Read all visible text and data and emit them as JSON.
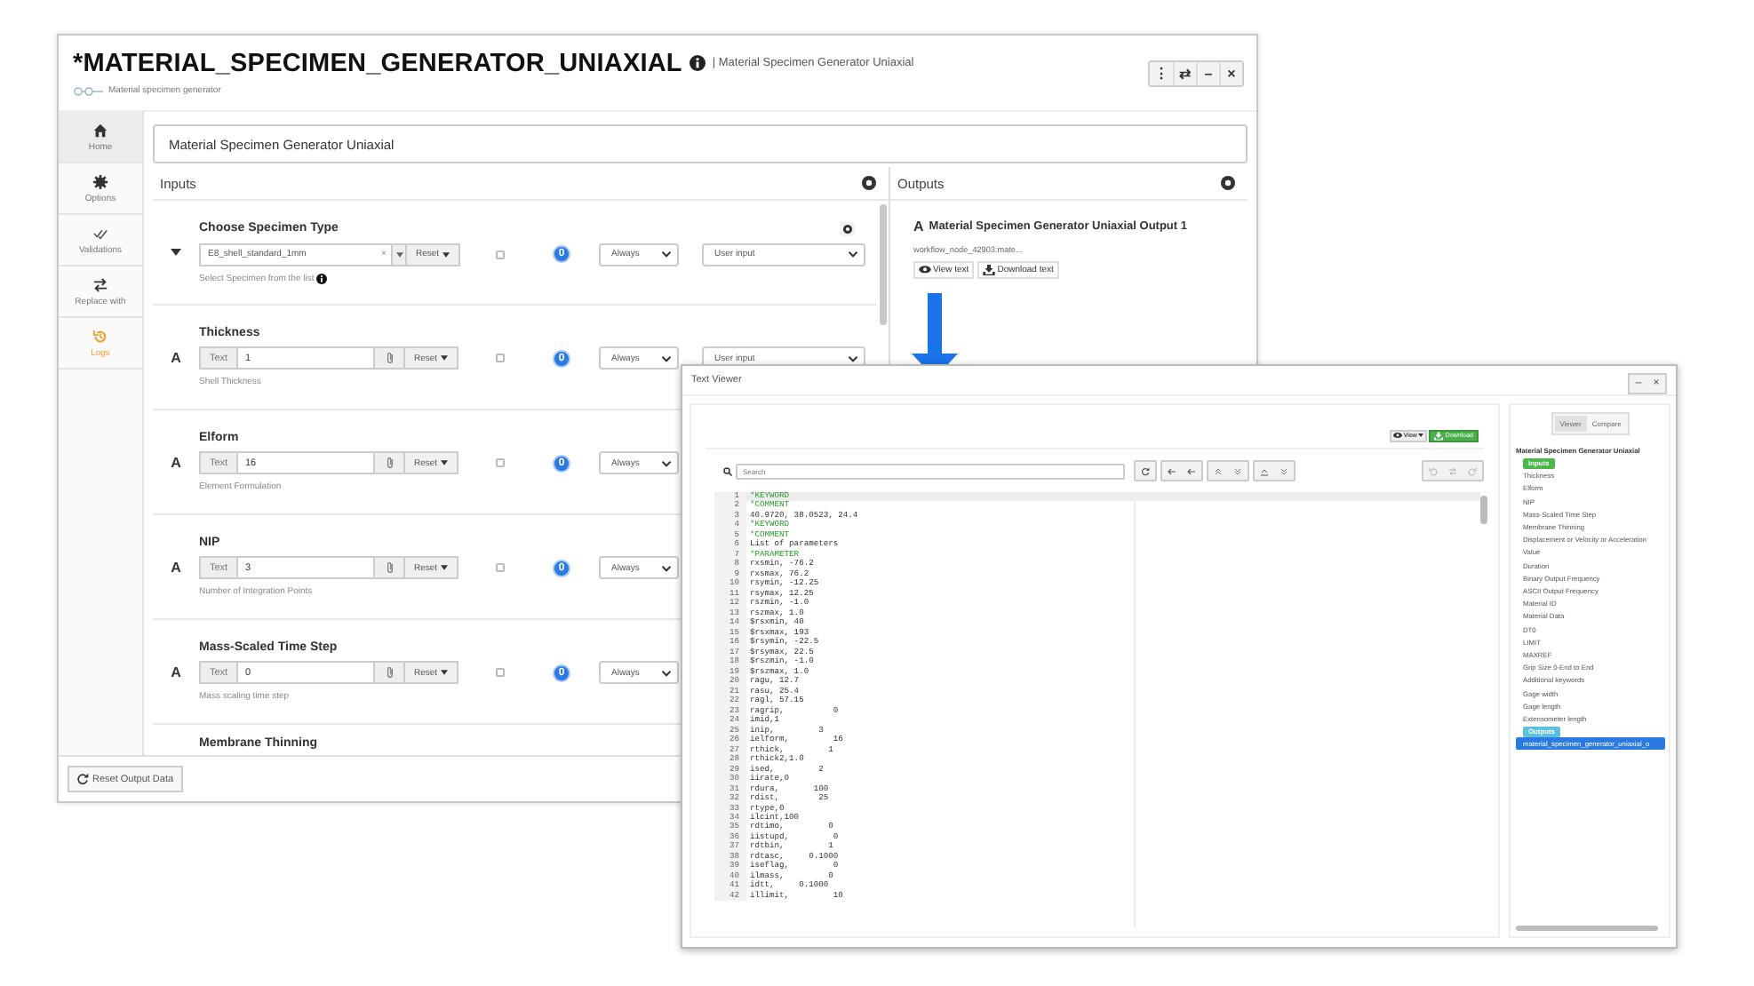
{
  "window": {
    "title": "*MATERIAL_SPECIMEN_GENERATOR_UNIAXIAL",
    "subtitle": "| Material Specimen Generator Uniaxial",
    "description": "Material specimen generator",
    "controls": [
      "⋮",
      "⇄",
      "–",
      "×"
    ]
  },
  "sidebar": {
    "items": [
      {
        "label": "Home",
        "selected": true,
        "highlighted": false
      },
      {
        "label": "Options",
        "selected": false,
        "highlighted": false
      },
      {
        "label": "Validations",
        "selected": false,
        "highlighted": false
      },
      {
        "label": "Replace with",
        "selected": false,
        "highlighted": false
      },
      {
        "label": "Logs",
        "selected": false,
        "highlighted": true
      }
    ]
  },
  "name_field": {
    "value": "Material Specimen Generator Uniaxial"
  },
  "inputs": {
    "title": "Inputs",
    "rows": [
      {
        "kind": "select",
        "label": "Choose Specimen Type",
        "value": "E8_shell_standard_1mm",
        "clear": "×",
        "reset": "Reset",
        "hint": "Select Specimen from the list",
        "checked": false,
        "count": "0",
        "frequency": "Always",
        "source": "User input"
      },
      {
        "kind": "text",
        "type_label": "A",
        "label": "Thickness",
        "prefix": "Text",
        "value": "1",
        "reset": "Reset",
        "hint": "Shell Thickness",
        "checked": false,
        "count": "0",
        "frequency": "Always",
        "source": "User input"
      },
      {
        "kind": "text",
        "type_label": "A",
        "label": "Elform",
        "prefix": "Text",
        "value": "16",
        "reset": "Reset",
        "hint": "Element Formulation",
        "checked": false,
        "count": "0",
        "frequency": "Always"
      },
      {
        "kind": "text",
        "type_label": "A",
        "label": "NIP",
        "prefix": "Text",
        "value": "3",
        "reset": "Reset",
        "hint": "Number of Integration Points",
        "checked": false,
        "count": "0",
        "frequency": "Always"
      },
      {
        "kind": "text",
        "type_label": "A",
        "label": "Mass-Scaled Time Step",
        "prefix": "Text",
        "value": "0",
        "reset": "Reset",
        "hint": "Mass scaling time step",
        "checked": false,
        "count": "0",
        "frequency": "Always"
      },
      {
        "kind": "cut",
        "label": "Membrane Thinning"
      }
    ]
  },
  "outputs": {
    "title": "Outputs",
    "item": {
      "type_label": "A",
      "title": "Material Specimen Generator Uniaxial Output 1",
      "path": "workflow_node_42903:mate...",
      "buttons": [
        "View text",
        "Download text"
      ]
    }
  },
  "footer": {
    "reset_button": "Reset Output Data"
  },
  "viewer": {
    "title": "Text Viewer",
    "controls": [
      "–",
      "×"
    ],
    "view_button": "View",
    "download_button": "Download",
    "search": {
      "placeholder": "Search"
    },
    "lines": [
      {
        "number": "1",
        "kind": "keyword",
        "text": "*KEYWORD"
      },
      {
        "number": "2",
        "kind": "keyword",
        "text": "*COMMENT"
      },
      {
        "number": "3",
        "kind": "plain",
        "text": "40.9720, 38.0523, 24.4"
      },
      {
        "number": "4",
        "kind": "keyword",
        "text": "*KEYWORD"
      },
      {
        "number": "5",
        "kind": "keyword",
        "text": "*COMMENT"
      },
      {
        "number": "6",
        "kind": "plain",
        "text": "List of parameters"
      },
      {
        "number": "7",
        "kind": "keyword",
        "text": "*PARAMETER"
      },
      {
        "number": "8",
        "kind": "plain",
        "text": "rxsmin, -76.2"
      },
      {
        "number": "9",
        "kind": "plain",
        "text": "rxsmax, 76.2"
      },
      {
        "number": "10",
        "kind": "plain",
        "text": "rsymin, -12.25"
      },
      {
        "number": "11",
        "kind": "plain",
        "text": "rsymax, 12.25"
      },
      {
        "number": "12",
        "kind": "plain",
        "text": "rszmin, -1.0"
      },
      {
        "number": "13",
        "kind": "plain",
        "text": "rszmax, 1.0"
      },
      {
        "number": "14",
        "kind": "plain",
        "text": "$rsxmin, 40"
      },
      {
        "number": "15",
        "kind": "plain",
        "text": "$rsxmax, 193"
      },
      {
        "number": "16",
        "kind": "plain",
        "text": "$rsymin, -22.5"
      },
      {
        "number": "17",
        "kind": "plain",
        "text": "$rsymax, 22.5"
      },
      {
        "number": "18",
        "kind": "plain",
        "text": "$rszmin, -1.0"
      },
      {
        "number": "19",
        "kind": "plain",
        "text": "$rszmax, 1.0"
      },
      {
        "number": "20",
        "kind": "plain",
        "text": "ragu, 12.7"
      },
      {
        "number": "21",
        "kind": "plain",
        "text": "rasu, 25.4"
      },
      {
        "number": "22",
        "kind": "plain",
        "text": "ragl, 57.15"
      },
      {
        "number": "23",
        "kind": "plain",
        "text": "ragrip,          0"
      },
      {
        "number": "24",
        "kind": "plain",
        "text": "imid,1"
      },
      {
        "number": "25",
        "kind": "plain",
        "text": "inip,         3"
      },
      {
        "number": "26",
        "kind": "plain",
        "text": "ielform,         16"
      },
      {
        "number": "27",
        "kind": "plain",
        "text": "rthick,         1"
      },
      {
        "number": "28",
        "kind": "plain",
        "text": "rthick2,1.0"
      },
      {
        "number": "29",
        "kind": "plain",
        "text": "ised,         2"
      },
      {
        "number": "30",
        "kind": "plain",
        "text": "iirate,0"
      },
      {
        "number": "31",
        "kind": "plain",
        "text": "rdura,       100"
      },
      {
        "number": "32",
        "kind": "plain",
        "text": "rdist,        25"
      },
      {
        "number": "33",
        "kind": "plain",
        "text": "rtype,0"
      },
      {
        "number": "34",
        "kind": "plain",
        "text": "ilcint,100"
      },
      {
        "number": "35",
        "kind": "plain",
        "text": "rdtimo,         0"
      },
      {
        "number": "36",
        "kind": "plain",
        "text": "iistupd,         0"
      },
      {
        "number": "37",
        "kind": "plain",
        "text": "rdtbin,         1"
      },
      {
        "number": "38",
        "kind": "plain",
        "text": "rdtasc,     0.1000"
      },
      {
        "number": "39",
        "kind": "plain",
        "text": "iseflag,         0"
      },
      {
        "number": "40",
        "kind": "plain",
        "text": "ilmass,         0"
      },
      {
        "number": "41",
        "kind": "plain",
        "text": "idtt,     0.1000"
      },
      {
        "number": "42",
        "kind": "plain",
        "text": "illimit,         10"
      }
    ],
    "tabs": [
      {
        "label": "Viewer",
        "selected": true
      },
      {
        "label": "Compare",
        "selected": false
      }
    ],
    "tree": {
      "title": "Material Specimen Generator Uniaxial",
      "groups": [
        {
          "kind": "inputs",
          "label": "Inputs",
          "items": [
            {
              "label": "Thickness",
              "selected": false
            },
            {
              "label": "Elform",
              "selected": false
            },
            {
              "label": "NIP",
              "selected": false
            },
            {
              "label": "Mass-Scaled Time Step",
              "selected": false
            },
            {
              "label": "Membrane Thinning",
              "selected": false
            },
            {
              "label": "Displacement or Velocity or Acceleration",
              "selected": false
            },
            {
              "label": "Value",
              "selected": false
            },
            {
              "label": "Duration",
              "selected": false
            },
            {
              "label": "Binary Output Frequency",
              "selected": false
            },
            {
              "label": "ASCII Output Frequency",
              "selected": false
            },
            {
              "label": "Material ID",
              "selected": false
            },
            {
              "label": "Material Data",
              "selected": false
            },
            {
              "label": "DT0",
              "selected": false
            },
            {
              "label": "LIMIT",
              "selected": false
            },
            {
              "label": "MAXREF",
              "selected": false
            },
            {
              "label": "Grip Size 0-End to End",
              "selected": false
            },
            {
              "label": "Additional keywords",
              "selected": false
            },
            {
              "label": "Gage width",
              "selected": false
            },
            {
              "label": "Gage length",
              "selected": false
            },
            {
              "label": "Extensometer length",
              "selected": false
            }
          ]
        },
        {
          "kind": "outputs",
          "label": "Outputs",
          "items": [
            {
              "label": "material_specimen_generator_uniaxial_o",
              "selected": true
            }
          ]
        }
      ]
    }
  }
}
